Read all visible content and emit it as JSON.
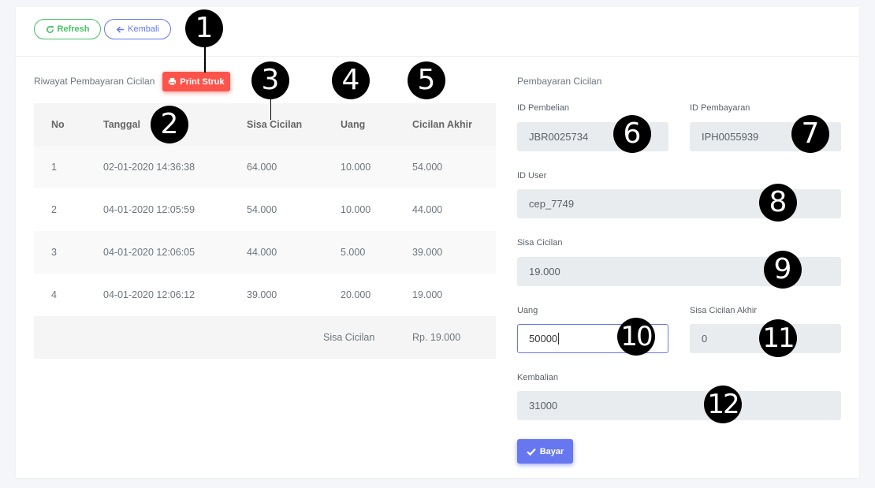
{
  "toolbar": {
    "refresh_label": "Refresh",
    "back_label": "Kembali",
    "refresh_icon": "refresh-icon",
    "back_icon": "arrow-left-icon"
  },
  "history": {
    "title": "Riwayat Pembayaran Cicilan",
    "print_label": "Print Struk",
    "print_icon": "printer-icon",
    "columns": [
      "No",
      "Tanggal",
      "Sisa Cicilan",
      "Uang",
      "Cicilan Akhir"
    ],
    "rows": [
      {
        "no": "1",
        "tanggal": "02-01-2020 14:36:38",
        "sisa": "64.000",
        "uang": "10.000",
        "akhir": "54.000"
      },
      {
        "no": "2",
        "tanggal": "04-01-2020 12:05:59",
        "sisa": "54.000",
        "uang": "10.000",
        "akhir": "44.000"
      },
      {
        "no": "3",
        "tanggal": "04-01-2020 12:06:05",
        "sisa": "44.000",
        "uang": "5.000",
        "akhir": "39.000"
      },
      {
        "no": "4",
        "tanggal": "04-01-2020 12:06:12",
        "sisa": "39.000",
        "uang": "20.000",
        "akhir": "19.000"
      }
    ],
    "summary_label": "Sisa Cicilan",
    "summary_value": "Rp. 19.000"
  },
  "payment": {
    "title": "Pembayaran Cicilan",
    "id_pembelian_label": "ID Pembelian",
    "id_pembelian_value": "JBR0025734",
    "id_pembayaran_label": "ID Pembayaran",
    "id_pembayaran_value": "IPH0055939",
    "id_user_label": "ID User",
    "id_user_value": "cep_7749",
    "sisa_label": "Sisa Cicilan",
    "sisa_value": "19.000",
    "uang_label": "Uang",
    "uang_value": "50000",
    "akhir_label": "Sisa Cicilan Akhir",
    "akhir_value": "0",
    "kembalian_label": "Kembalian",
    "kembalian_value": "31000",
    "pay_label": "Bayar",
    "pay_icon": "check-icon"
  },
  "markers": [
    "1",
    "2",
    "3",
    "4",
    "5",
    "6",
    "7",
    "8",
    "9",
    "10",
    "11",
    "12"
  ]
}
